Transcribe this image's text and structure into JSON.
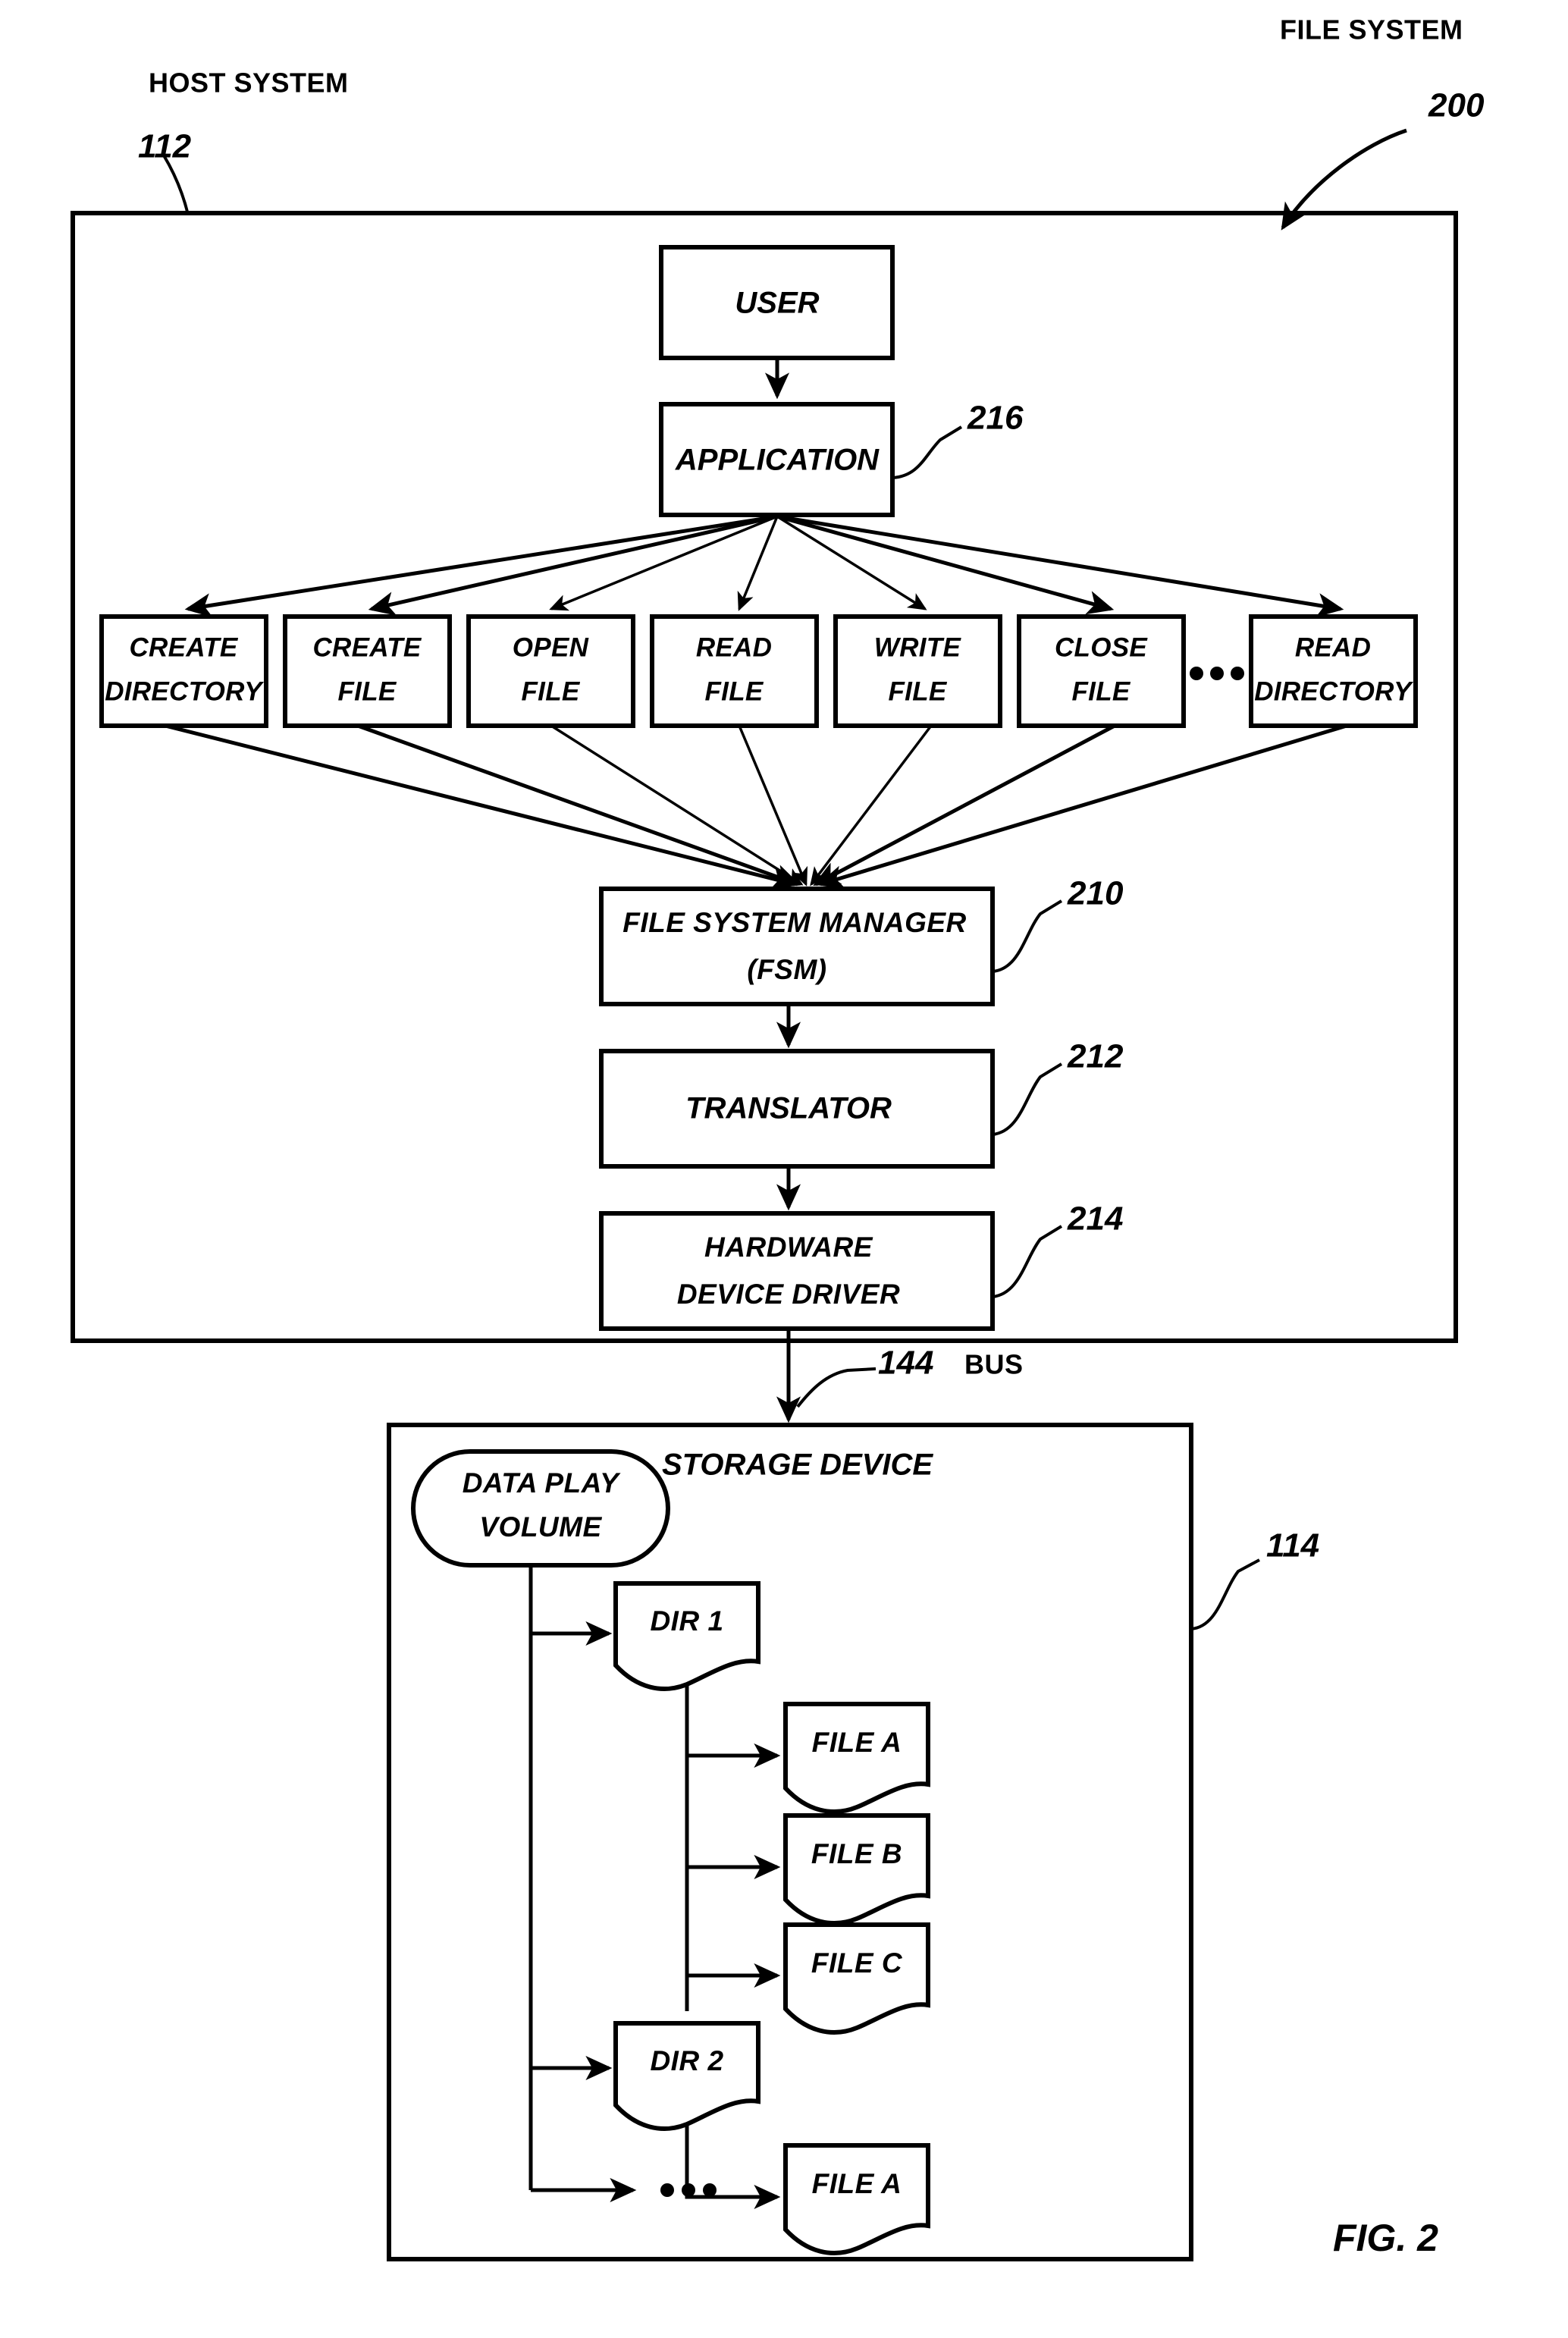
{
  "figure": {
    "fig_label": "FIG. 2",
    "title_right": "FILE SYSTEM",
    "title_left": "HOST SYSTEM",
    "ref_file_system": "200",
    "ref_host_system": "112",
    "ref_storage_device": "114",
    "ref_bus": "144",
    "bus_label": "BUS"
  },
  "host": {
    "user_box": {
      "label": "USER"
    },
    "application_box": {
      "label": "APPLICATION",
      "ref": "216"
    },
    "operations": [
      {
        "line1": "CREATE",
        "line2": "DIRECTORY"
      },
      {
        "line1": "CREATE",
        "line2": "FILE"
      },
      {
        "line1": "OPEN",
        "line2": "FILE"
      },
      {
        "line1": "READ",
        "line2": "FILE"
      },
      {
        "line1": "WRITE",
        "line2": "FILE"
      },
      {
        "line1": "CLOSE",
        "line2": "FILE"
      },
      {
        "line1": "READ",
        "line2": "DIRECTORY"
      }
    ],
    "operations_ellipsis": "...",
    "fsm_box": {
      "line1": "FILE SYSTEM MANAGER",
      "line2": "(FSM)",
      "ref": "210"
    },
    "translator_box": {
      "label": "TRANSLATOR",
      "ref": "212"
    },
    "driver_box": {
      "line1": "HARDWARE",
      "line2": "DEVICE DRIVER",
      "ref": "214"
    }
  },
  "storage": {
    "title": "STORAGE DEVICE",
    "volume": {
      "line1": "DATA PLAY",
      "line2": "VOLUME"
    },
    "tree": [
      {
        "label": "DIR 1",
        "type": "directory"
      },
      {
        "label": "FILE A",
        "type": "file"
      },
      {
        "label": "FILE B",
        "type": "file"
      },
      {
        "label": "FILE C",
        "type": "file"
      },
      {
        "label": "DIR 2",
        "type": "directory"
      },
      {
        "label": "FILE A",
        "type": "file"
      }
    ],
    "tree_ellipsis": "..."
  },
  "colors": {
    "ink": "#000000",
    "paper": "#ffffff"
  }
}
